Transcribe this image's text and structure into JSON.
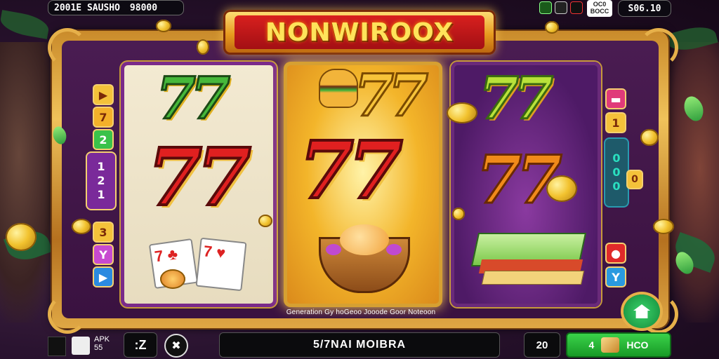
{
  "header": {
    "status_text": "2001E SAUSHO",
    "balance": "98000",
    "right_value": "S06.10",
    "odd_label_top": "OC0",
    "odd_label_bottom": "BOCC"
  },
  "game": {
    "title": "NONWIROOX",
    "reel_caption": "Generation Gy hoGeoo Jooode Goor Noteoon"
  },
  "left_panel": {
    "buttons": [
      "▶",
      "7",
      "2"
    ],
    "stack": [
      "1",
      "2",
      "1"
    ],
    "lower_buttons": [
      "3",
      "Y",
      "▶"
    ]
  },
  "right_panel": {
    "buttons": [
      "▬",
      "1"
    ],
    "stack": [
      "0",
      "0",
      "0"
    ],
    "side_badge": "0",
    "lower_buttons": [
      "●",
      "Y"
    ]
  },
  "reels": {
    "reel1": {
      "top": "77",
      "middle": "77"
    },
    "reel2": {
      "top": "77",
      "middle": "77"
    },
    "reel3": {
      "top": "77",
      "middle": "77"
    }
  },
  "bottom": {
    "apk_label": "APK",
    "apk_value": "55",
    "bet_display": ":Z",
    "message": "5/7NAI MOIBRA",
    "lines_value": "20",
    "spin_value": "4",
    "spin_amount": "HCO"
  },
  "colors": {
    "accent_gold": "#e6b04a",
    "title_red": "#d8201e",
    "spin_green": "#2ab83a"
  },
  "icons": [
    "seven-symbol",
    "burger-symbol",
    "cards-symbol",
    "basket-symbol",
    "sandwich-symbol",
    "coin-icon",
    "home-icon"
  ]
}
